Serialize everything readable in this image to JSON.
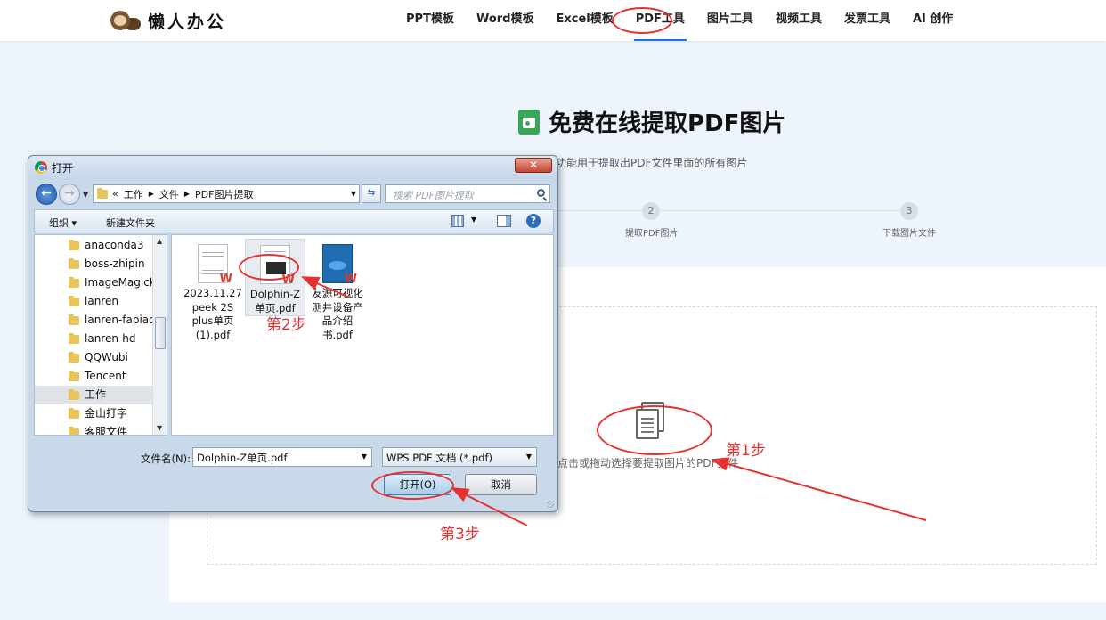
{
  "site": {
    "logo_text": "懒人办公",
    "nav": [
      "PPT模板",
      "Word模板",
      "Excel模板",
      "PDF工具",
      "图片工具",
      "视频工具",
      "发票工具",
      "AI 创作"
    ],
    "active_nav": "PDF工具"
  },
  "page": {
    "title": "免费在线提取PDF图片",
    "subtitle": "功能用于提取出PDF文件里面的所有图片",
    "steps": [
      {
        "num": "2",
        "label": "提取PDF图片"
      },
      {
        "num": "3",
        "label": "下载图片文件"
      }
    ],
    "upload_hint": "点击或拖动选择要提取图片的PDF文件"
  },
  "annotations": {
    "step1": "第1步",
    "step2": "第2步",
    "step3": "第3步",
    "color": "#e53131"
  },
  "dialog": {
    "title": "打开",
    "close_label": "✕",
    "address": {
      "prefix": "«",
      "crumbs": [
        "工作",
        "文件",
        "PDF图片提取"
      ]
    },
    "search_placeholder": "搜索 PDF图片提取",
    "toolbar": {
      "organize": "组织 ▾",
      "new_folder": "新建文件夹",
      "help": "?"
    },
    "tree": [
      "anaconda3",
      "boss-zhipin",
      "ImageMagick",
      "lanren",
      "lanren-fapiao",
      "lanren-hd",
      "QQWubi",
      "Tencent",
      "工作",
      "金山打字",
      "客服文件"
    ],
    "selected_tree": "工作",
    "files": [
      {
        "name": "2023.11.27 peek 2S plus单页 (1).pdf"
      },
      {
        "name": "Dolphin-Z单页.pdf"
      },
      {
        "name": "友源可视化测井设备产品介绍书.pdf"
      }
    ],
    "selected_file": "Dolphin-Z单页.pdf",
    "filename_label": "文件名(N):",
    "filename_value": "Dolphin-Z单页.pdf",
    "filetype_value": "WPS PDF 文档 (*.pdf)",
    "open_button": "打开(O)",
    "cancel_button": "取消"
  }
}
